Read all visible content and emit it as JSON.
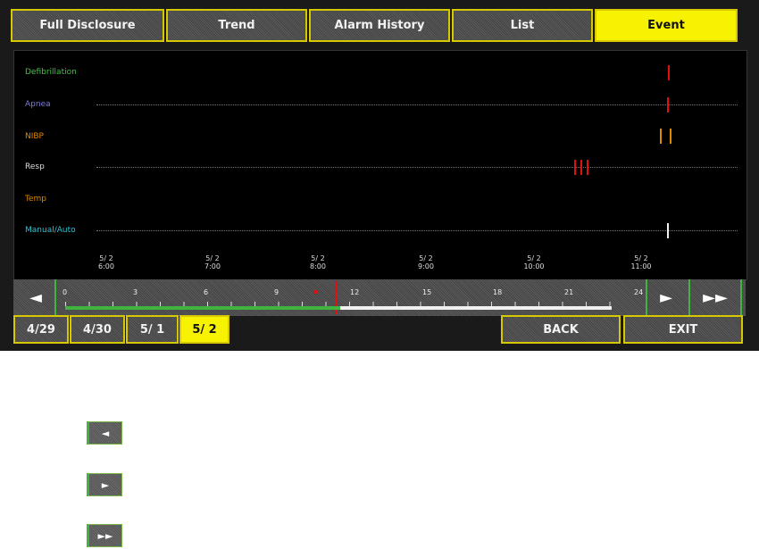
{
  "tabs": [
    {
      "label": "Full Disclosure",
      "active": false
    },
    {
      "label": "Trend",
      "active": false
    },
    {
      "label": "Alarm History",
      "active": false
    },
    {
      "label": "List",
      "active": false
    },
    {
      "label": "Event",
      "active": true
    }
  ],
  "event_rows": [
    {
      "label": "Defibrillation",
      "color": "#3fc83f"
    },
    {
      "label": "Apnea",
      "color": "#7b7bd8"
    },
    {
      "label": "NIBP",
      "color": "#e08a00"
    },
    {
      "label": "Resp",
      "color": "#dddddd"
    },
    {
      "label": "Temp",
      "color": "#e08a00"
    },
    {
      "label": "Manual/Auto",
      "color": "#30c0d0"
    }
  ],
  "time_axis": [
    {
      "date": "5/ 2",
      "time": "6:00"
    },
    {
      "date": "5/ 2",
      "time": "7:00"
    },
    {
      "date": "5/ 2",
      "time": "8:00"
    },
    {
      "date": "5/ 2",
      "time": "9:00"
    },
    {
      "date": "5/ 2",
      "time": "10:00"
    },
    {
      "date": "5/ 2",
      "time": "11:00"
    }
  ],
  "timeline_hours": [
    "0",
    "3",
    "6",
    "9",
    "12",
    "15",
    "18",
    "21",
    "24"
  ],
  "nav": {
    "prev_icon": "triangle-left-icon",
    "next_icon": "triangle-right-icon",
    "fast_forward_icon": "fast-forward-icon"
  },
  "days": [
    {
      "label": "4/29",
      "active": false
    },
    {
      "label": "4/30",
      "active": false
    },
    {
      "label": "5/ 1",
      "active": false
    },
    {
      "label": "5/ 2",
      "active": true
    }
  ],
  "buttons": {
    "back": "BACK",
    "exit": "EXIT"
  },
  "legend": [
    {
      "glyph": "◄",
      "icon": "triangle-left-icon"
    },
    {
      "glyph": "►",
      "icon": "triangle-right-icon"
    },
    {
      "glyph": "►►",
      "icon": "fast-forward-icon"
    }
  ],
  "colors": {
    "accent_yellow": "#f7f200",
    "border_yellow": "#d8c800",
    "marker_red": "#e01010",
    "timeline_green": "#3fb53f"
  }
}
